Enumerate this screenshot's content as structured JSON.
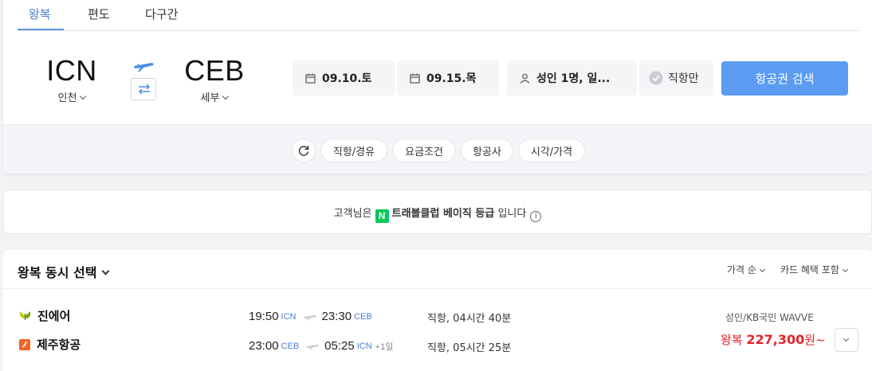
{
  "tabs": [
    {
      "label": "왕복"
    },
    {
      "label": "편도"
    },
    {
      "label": "다구간"
    }
  ],
  "route": {
    "origin": {
      "code": "ICN",
      "name": "인천"
    },
    "destination": {
      "code": "CEB",
      "name": "세부"
    }
  },
  "icons": {
    "swap": "swap-arrows-icon",
    "plane": "airplane-icon",
    "calendar": "calendar-icon",
    "person": "person-icon",
    "check": "check-circle-icon",
    "refresh": "refresh-icon",
    "info": "info-icon"
  },
  "dates": {
    "depart": "09.10.토",
    "return": "09.15.목"
  },
  "passengers": {
    "label": "성인 1명, 일..."
  },
  "direct_toggle": {
    "label": "직항만"
  },
  "search_button": {
    "label": "항공권 검색"
  },
  "colors": {
    "accent": "#5b9cf2",
    "price": "#e8222a",
    "naver_green": "#03c75a",
    "airport_code": "#4a7fd4"
  },
  "filters": [
    {
      "label": "직항/경유"
    },
    {
      "label": "요금조건"
    },
    {
      "label": "항공사"
    },
    {
      "label": "시각/가격"
    }
  ],
  "membership": {
    "prefix": "고객님은",
    "badge": "N",
    "grade": "트래블클럽 베이직 등급",
    "suffix": "입니다",
    "info_glyph": "i"
  },
  "results": {
    "title": "왕복 동시 선택",
    "sort_price": "가격 순",
    "sort_card": "카드 혜택 포함",
    "itinerary": {
      "outbound": {
        "airline": "진에어",
        "depart_time": "19:50",
        "depart_airport": "ICN",
        "arrive_time": "23:30",
        "arrive_airport": "CEB",
        "duration": "직항, 04시간 40분"
      },
      "inbound": {
        "airline": "제주항공",
        "depart_time": "23:00",
        "depart_airport": "CEB",
        "arrive_time": "05:25",
        "arrive_airport": "ICN",
        "day_offset": "+1일",
        "duration": "직항, 05시간 25분"
      },
      "fare_label": "성인/KB국민 WAVVE",
      "price_prefix": "왕복",
      "price_value": "227,300",
      "price_suffix": "원~"
    }
  }
}
